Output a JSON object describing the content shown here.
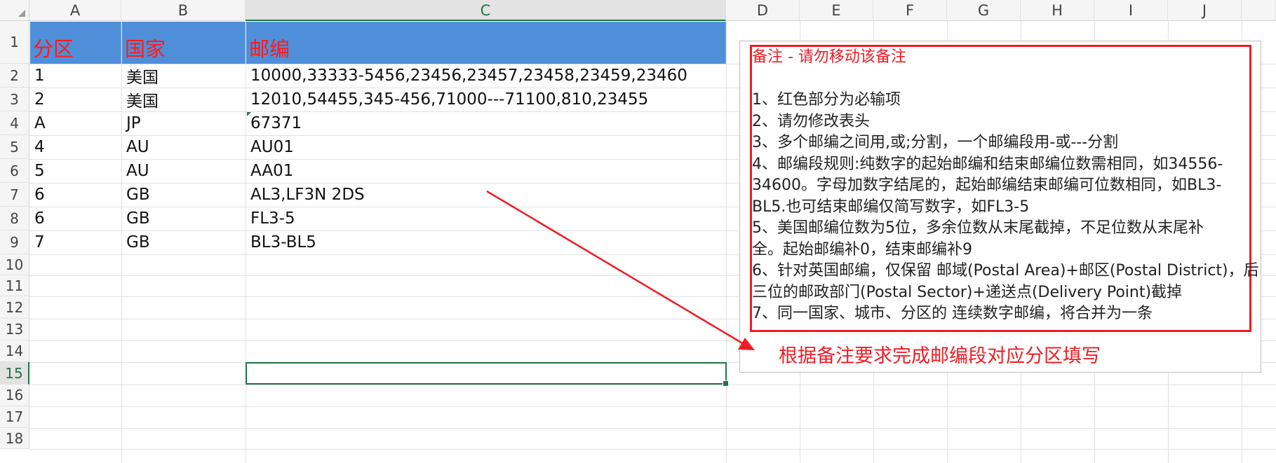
{
  "sheet": {
    "columns": [
      "A",
      "B",
      "C",
      "D",
      "E",
      "F",
      "G",
      "H",
      "I",
      "J"
    ],
    "rows": [
      "1",
      "2",
      "3",
      "4",
      "5",
      "6",
      "7",
      "8",
      "9",
      "10",
      "11",
      "12",
      "13",
      "14",
      "15",
      "16",
      "17",
      "18"
    ],
    "header_row": [
      "分区",
      "国家",
      "邮编"
    ],
    "data_rows": [
      [
        "1",
        "美国",
        "10000,33333-5456,23456,23457,23458,23459,23460"
      ],
      [
        "2",
        "美国",
        "12010,54455,345-456,71000---71100,810,23455"
      ],
      [
        "A",
        "JP",
        "67371"
      ],
      [
        "4",
        "AU",
        "AU01"
      ],
      [
        "5",
        "AU",
        "AA01"
      ],
      [
        "6",
        "GB",
        "AL3,LF3N 2DS"
      ],
      [
        "6",
        "GB",
        "FL3-5"
      ],
      [
        "7",
        "GB",
        "BL3-BL5"
      ]
    ],
    "selected_cell": "C15",
    "selected_column": "C",
    "selected_row": "15",
    "header_fill_color": "#4f8fd9",
    "header_text_color": "#ff1a1a",
    "selection_color": "#217346"
  },
  "note": {
    "title": "备注 - 请勿移动该备注",
    "lines": [
      "1、红色部分为必输项",
      "2、请勿修改表头",
      "3、多个邮编之间用,或;分割，一个邮编段用-或---分割",
      "4、邮编段规则:纯数字的起始邮编和结束邮编位数需相同，如34556-",
      "34600。字母加数字结尾的，起始邮编结束邮编可位数相同，如BL3-",
      "BL5.也可结束邮编仅简写数字，如FL3-5",
      "5、美国邮编位数为5位，多余位数从末尾截掉，不足位数从末尾补",
      "全。起始邮编补0，结束邮编补9",
      "6、针对英国邮编，仅保留 邮域(Postal Area)+邮区(Postal District)，后",
      "三位的邮政部门(Postal Sector)+递送点(Delivery Point)截掉",
      "7、同一国家、城市、分区的 连续数字邮编，将合并为一条"
    ],
    "border_color": "#ee1c24"
  },
  "callout": {
    "text": "根据备注要求完成邮编段对应分区填写",
    "color": "#ee1c24"
  }
}
